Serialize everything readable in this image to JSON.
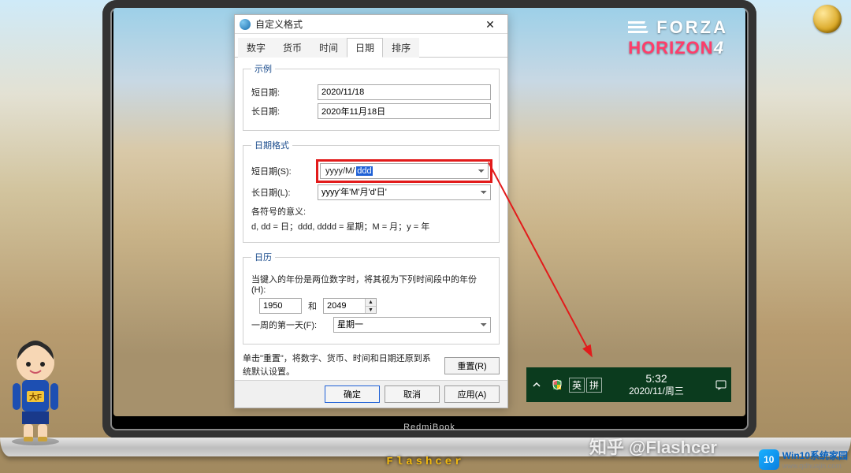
{
  "laptop_brand": "RedmiBook",
  "coin_icon": "gold-coin",
  "forza": {
    "line1": "FORZA",
    "line2_a": "HORIZON",
    "line2_b": "4"
  },
  "dialog": {
    "title": "自定义格式",
    "tabs": [
      "数字",
      "货币",
      "时间",
      "日期",
      "排序"
    ],
    "active_tab_index": 3,
    "example": {
      "legend": "示例",
      "short_label": "短日期:",
      "short_value": "2020/11/18",
      "long_label": "长日期:",
      "long_value": "2020年11月18日"
    },
    "formats": {
      "legend": "日期格式",
      "short_label": "短日期(S):",
      "short_prefix": "yyyy/M/",
      "short_highlight": "ddd",
      "long_label": "长日期(L):",
      "long_value": "yyyy'年'M'月'd'日'",
      "meaning_label": "各符号的意义:",
      "meaning_text": "d, dd = 日；ddd, dddd = 星期；M = 月；y = 年"
    },
    "calendar": {
      "legend": "日历",
      "two_digit_label": "当键入的年份是两位数字时，将其视为下列时间段中的年份(H):",
      "year_from": "1950",
      "between": "和",
      "year_to": "2049",
      "first_day_label": "一周的第一天(F):",
      "first_day_value": "星期一"
    },
    "reset_note": "单击\"重置\"，将数字、货币、时间和日期还原到系统默认设置。",
    "reset_btn": "重置(R)",
    "ok": "确定",
    "cancel": "取消",
    "apply": "应用(A)"
  },
  "taskbar": {
    "shield_icon": "defender-shield",
    "ime_lang": "英",
    "ime_mode": "拼",
    "time": "5:32",
    "date": "2020/11/周三"
  },
  "watermarks": {
    "zhihu": "知乎 @Flashcer",
    "author": "Flashcer",
    "site_name": "Win10系统家园",
    "site_url": "www.qdhuajin.com",
    "site_badge": "10"
  }
}
